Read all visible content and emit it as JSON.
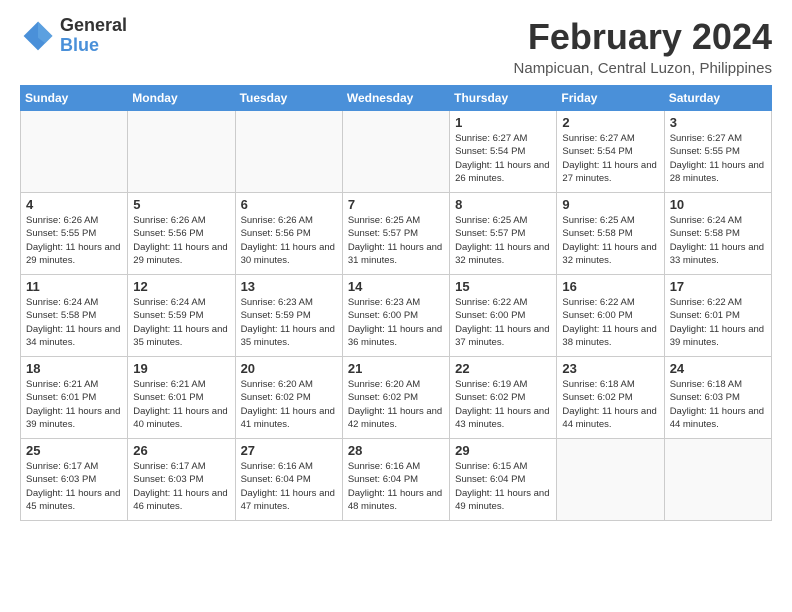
{
  "header": {
    "logo_line1": "General",
    "logo_line2": "Blue",
    "month": "February 2024",
    "location": "Nampicuan, Central Luzon, Philippines"
  },
  "weekdays": [
    "Sunday",
    "Monday",
    "Tuesday",
    "Wednesday",
    "Thursday",
    "Friday",
    "Saturday"
  ],
  "weeks": [
    [
      {
        "num": "",
        "info": ""
      },
      {
        "num": "",
        "info": ""
      },
      {
        "num": "",
        "info": ""
      },
      {
        "num": "",
        "info": ""
      },
      {
        "num": "1",
        "info": "Sunrise: 6:27 AM\nSunset: 5:54 PM\nDaylight: 11 hours\nand 26 minutes."
      },
      {
        "num": "2",
        "info": "Sunrise: 6:27 AM\nSunset: 5:54 PM\nDaylight: 11 hours\nand 27 minutes."
      },
      {
        "num": "3",
        "info": "Sunrise: 6:27 AM\nSunset: 5:55 PM\nDaylight: 11 hours\nand 28 minutes."
      }
    ],
    [
      {
        "num": "4",
        "info": "Sunrise: 6:26 AM\nSunset: 5:55 PM\nDaylight: 11 hours\nand 29 minutes."
      },
      {
        "num": "5",
        "info": "Sunrise: 6:26 AM\nSunset: 5:56 PM\nDaylight: 11 hours\nand 29 minutes."
      },
      {
        "num": "6",
        "info": "Sunrise: 6:26 AM\nSunset: 5:56 PM\nDaylight: 11 hours\nand 30 minutes."
      },
      {
        "num": "7",
        "info": "Sunrise: 6:25 AM\nSunset: 5:57 PM\nDaylight: 11 hours\nand 31 minutes."
      },
      {
        "num": "8",
        "info": "Sunrise: 6:25 AM\nSunset: 5:57 PM\nDaylight: 11 hours\nand 32 minutes."
      },
      {
        "num": "9",
        "info": "Sunrise: 6:25 AM\nSunset: 5:58 PM\nDaylight: 11 hours\nand 32 minutes."
      },
      {
        "num": "10",
        "info": "Sunrise: 6:24 AM\nSunset: 5:58 PM\nDaylight: 11 hours\nand 33 minutes."
      }
    ],
    [
      {
        "num": "11",
        "info": "Sunrise: 6:24 AM\nSunset: 5:58 PM\nDaylight: 11 hours\nand 34 minutes."
      },
      {
        "num": "12",
        "info": "Sunrise: 6:24 AM\nSunset: 5:59 PM\nDaylight: 11 hours\nand 35 minutes."
      },
      {
        "num": "13",
        "info": "Sunrise: 6:23 AM\nSunset: 5:59 PM\nDaylight: 11 hours\nand 35 minutes."
      },
      {
        "num": "14",
        "info": "Sunrise: 6:23 AM\nSunset: 6:00 PM\nDaylight: 11 hours\nand 36 minutes."
      },
      {
        "num": "15",
        "info": "Sunrise: 6:22 AM\nSunset: 6:00 PM\nDaylight: 11 hours\nand 37 minutes."
      },
      {
        "num": "16",
        "info": "Sunrise: 6:22 AM\nSunset: 6:00 PM\nDaylight: 11 hours\nand 38 minutes."
      },
      {
        "num": "17",
        "info": "Sunrise: 6:22 AM\nSunset: 6:01 PM\nDaylight: 11 hours\nand 39 minutes."
      }
    ],
    [
      {
        "num": "18",
        "info": "Sunrise: 6:21 AM\nSunset: 6:01 PM\nDaylight: 11 hours\nand 39 minutes."
      },
      {
        "num": "19",
        "info": "Sunrise: 6:21 AM\nSunset: 6:01 PM\nDaylight: 11 hours\nand 40 minutes."
      },
      {
        "num": "20",
        "info": "Sunrise: 6:20 AM\nSunset: 6:02 PM\nDaylight: 11 hours\nand 41 minutes."
      },
      {
        "num": "21",
        "info": "Sunrise: 6:20 AM\nSunset: 6:02 PM\nDaylight: 11 hours\nand 42 minutes."
      },
      {
        "num": "22",
        "info": "Sunrise: 6:19 AM\nSunset: 6:02 PM\nDaylight: 11 hours\nand 43 minutes."
      },
      {
        "num": "23",
        "info": "Sunrise: 6:18 AM\nSunset: 6:02 PM\nDaylight: 11 hours\nand 44 minutes."
      },
      {
        "num": "24",
        "info": "Sunrise: 6:18 AM\nSunset: 6:03 PM\nDaylight: 11 hours\nand 44 minutes."
      }
    ],
    [
      {
        "num": "25",
        "info": "Sunrise: 6:17 AM\nSunset: 6:03 PM\nDaylight: 11 hours\nand 45 minutes."
      },
      {
        "num": "26",
        "info": "Sunrise: 6:17 AM\nSunset: 6:03 PM\nDaylight: 11 hours\nand 46 minutes."
      },
      {
        "num": "27",
        "info": "Sunrise: 6:16 AM\nSunset: 6:04 PM\nDaylight: 11 hours\nand 47 minutes."
      },
      {
        "num": "28",
        "info": "Sunrise: 6:16 AM\nSunset: 6:04 PM\nDaylight: 11 hours\nand 48 minutes."
      },
      {
        "num": "29",
        "info": "Sunrise: 6:15 AM\nSunset: 6:04 PM\nDaylight: 11 hours\nand 49 minutes."
      },
      {
        "num": "",
        "info": ""
      },
      {
        "num": "",
        "info": ""
      }
    ]
  ]
}
